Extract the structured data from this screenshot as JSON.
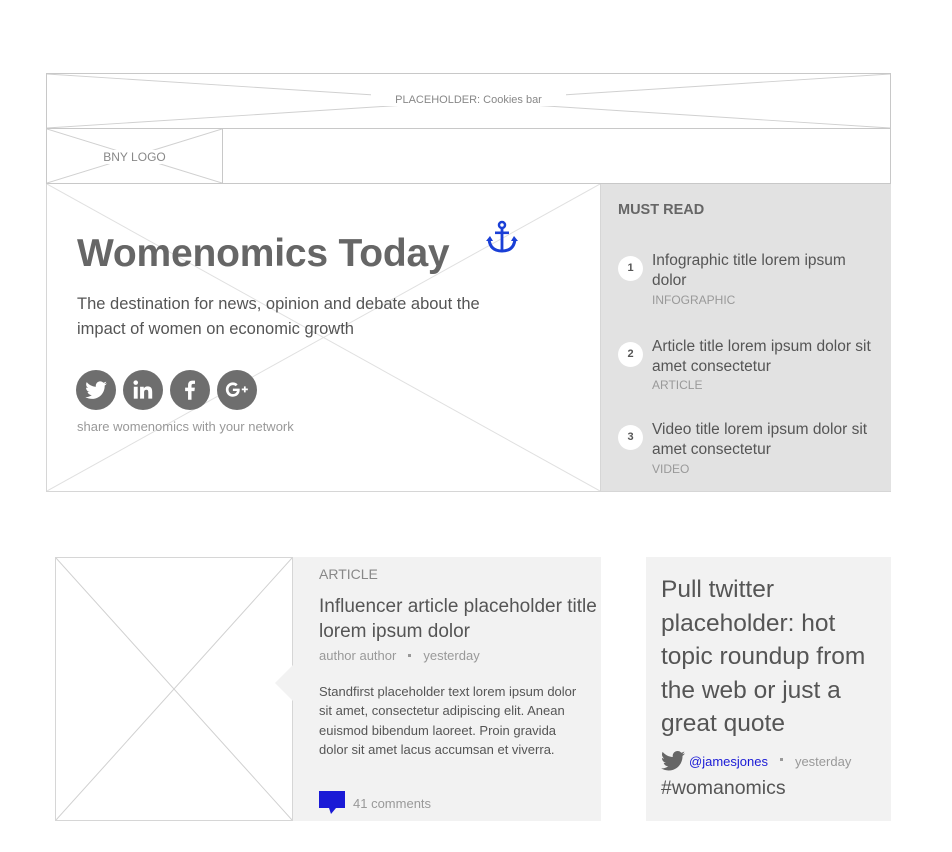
{
  "cookies_bar": {
    "label": "PLACEHOLDER: Cookies bar"
  },
  "header": {
    "logo_label": "BNY LOGO"
  },
  "hero": {
    "title": "Womenomics Today",
    "subtitle": "The destination for news, opinion and debate about the impact of women on economic growth",
    "social_icons": [
      "twitter-icon",
      "linkedin-icon",
      "facebook-icon",
      "google-plus-icon"
    ],
    "share_text": "share womenomics with your network",
    "anchor_color": "#1a3fd6"
  },
  "must_read": {
    "title": "MUST READ",
    "items": [
      {
        "number": "1",
        "title": "Infographic title lorem ipsum dolor",
        "type": "INFOGRAPHIC"
      },
      {
        "number": "2",
        "title": "Article title lorem ipsum dolor sit amet consectetur",
        "type": "ARTICLE"
      },
      {
        "number": "3",
        "title": "Video title lorem ipsum dolor sit amet consectetur",
        "type": "VIDEO"
      }
    ]
  },
  "article": {
    "kicker": "ARTICLE",
    "title": "Influencer article placeholder title lorem ipsum dolor",
    "author": "author author",
    "time": "yesterday",
    "standfirst": "Standfirst placeholder text lorem ipsum dolor sit amet, consectetur adipiscing elit. Anean euismod bibendum laoreet. Proin gravida dolor sit amet lacus accumsan et viverra.",
    "comments": "41 comments",
    "comment_icon_color": "#1a1ad6"
  },
  "twitter": {
    "quote": "Pull twitter placeholder: hot topic roundup from the web or just a great quote",
    "handle": "@jamesjones",
    "time": "yesterday",
    "hashtag": "#womanomics",
    "handle_color": "#1a1ad6"
  }
}
